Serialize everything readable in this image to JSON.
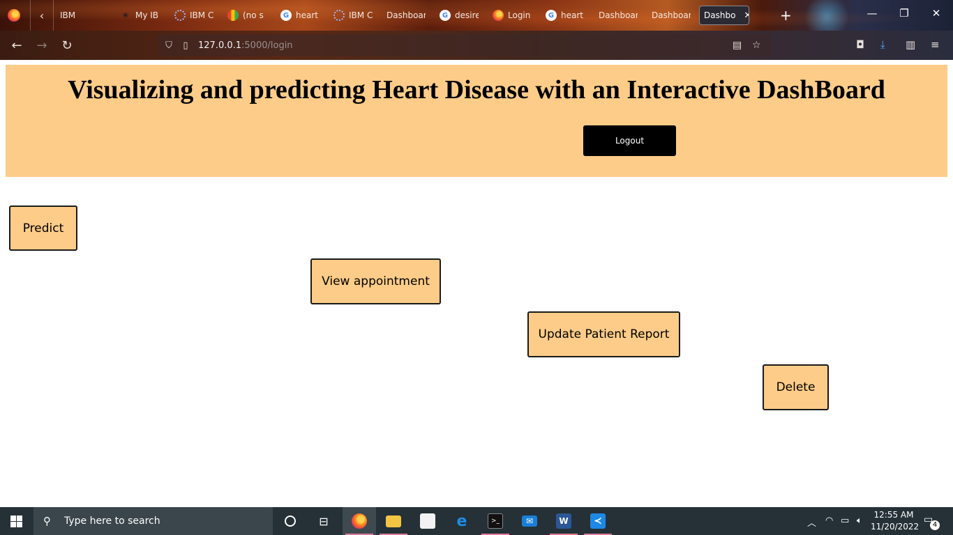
{
  "browser": {
    "tabs": [
      {
        "label": "IBM",
        "favicon": "none"
      },
      {
        "label": "My IB",
        "favicon": "bee-icon"
      },
      {
        "label": "IBM C",
        "favicon": "ibm-cloud-icon"
      },
      {
        "label": "(no s",
        "favicon": "gmail-icon"
      },
      {
        "label": "heart",
        "favicon": "google-icon"
      },
      {
        "label": "IBM C",
        "favicon": "ibm-cloud-icon"
      },
      {
        "label": "Dashboar",
        "favicon": "none"
      },
      {
        "label": "desire",
        "favicon": "google-icon"
      },
      {
        "label": "Login",
        "favicon": "firefox-icon"
      },
      {
        "label": "heart",
        "favicon": "google-icon"
      },
      {
        "label": "Dashboar",
        "favicon": "none"
      },
      {
        "label": "Dashboar",
        "favicon": "none"
      },
      {
        "label": "Dashbo",
        "favicon": "none",
        "active": true
      }
    ],
    "url_host": "127.0.0.1",
    "url_rest": ":5000/login"
  },
  "page": {
    "title": "Visualizing and predicting Heart Disease with an Interactive DashBoard",
    "logout_label": "Logout",
    "buttons": {
      "predict": "Predict",
      "view_appointment": "View appointment",
      "update_report": "Update Patient Report",
      "delete": "Delete"
    },
    "colors": {
      "header_bg": "#fdcc88",
      "button_bg": "#fdcc88",
      "logout_bg": "#000000"
    }
  },
  "taskbar": {
    "search_placeholder": "Type here to search",
    "time": "12:55 AM",
    "date": "11/20/2022",
    "notifications_count": "4"
  }
}
